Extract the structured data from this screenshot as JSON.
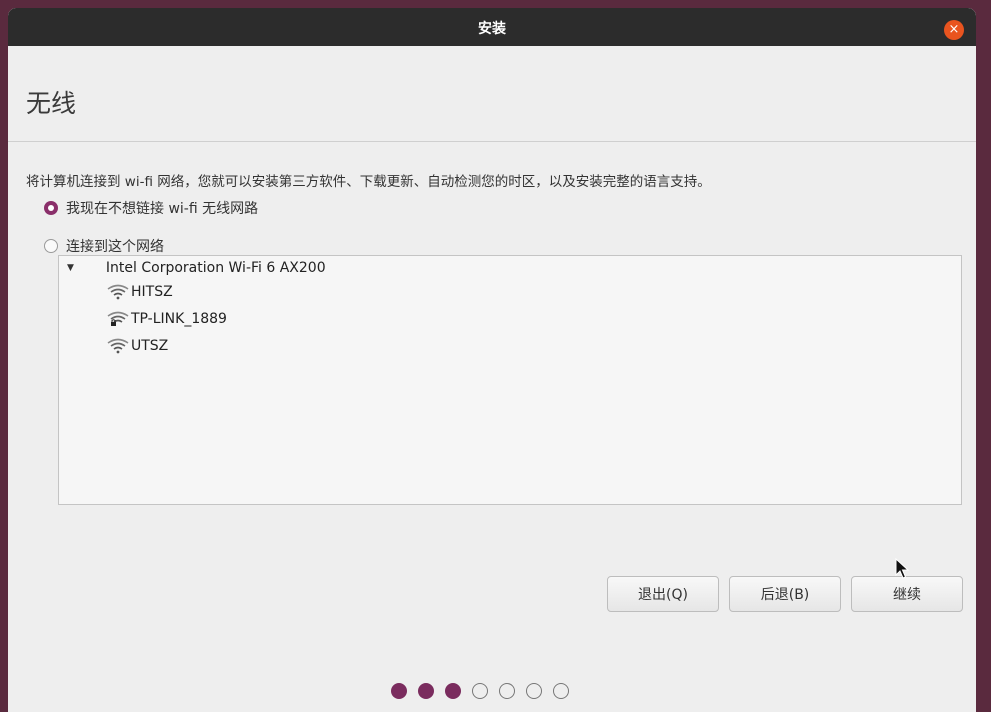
{
  "window": {
    "title": "安装",
    "close_label": "×"
  },
  "page": {
    "heading": "无线",
    "description": "将计算机连接到 wi-fi 网络，您就可以安装第三方软件、下载更新、自动检测您的时区，以及安装完整的语言支持。"
  },
  "options": {
    "no_wifi": {
      "label": "我现在不想链接 wi-fi 无线网路",
      "selected": true
    },
    "connect": {
      "label": "连接到这个网络",
      "selected": false
    }
  },
  "network_list": {
    "device": "Intel Corporation Wi-Fi 6 AX200",
    "expanded": true,
    "networks": [
      {
        "ssid": "HITSZ",
        "secured": false,
        "icon": "wifi-signal-icon"
      },
      {
        "ssid": "TP-LINK_1889",
        "secured": true,
        "icon": "wifi-secure-icon"
      },
      {
        "ssid": "UTSZ",
        "secured": false,
        "icon": "wifi-signal-icon"
      }
    ]
  },
  "buttons": {
    "quit": "退出(Q)",
    "back": "后退(B)",
    "continue": "继续"
  },
  "progress": {
    "current_step": 3,
    "total_steps": 7
  },
  "colors": {
    "accent": "#7a2c5e",
    "titlebar": "#2c2c2c",
    "close": "#e9541f"
  }
}
